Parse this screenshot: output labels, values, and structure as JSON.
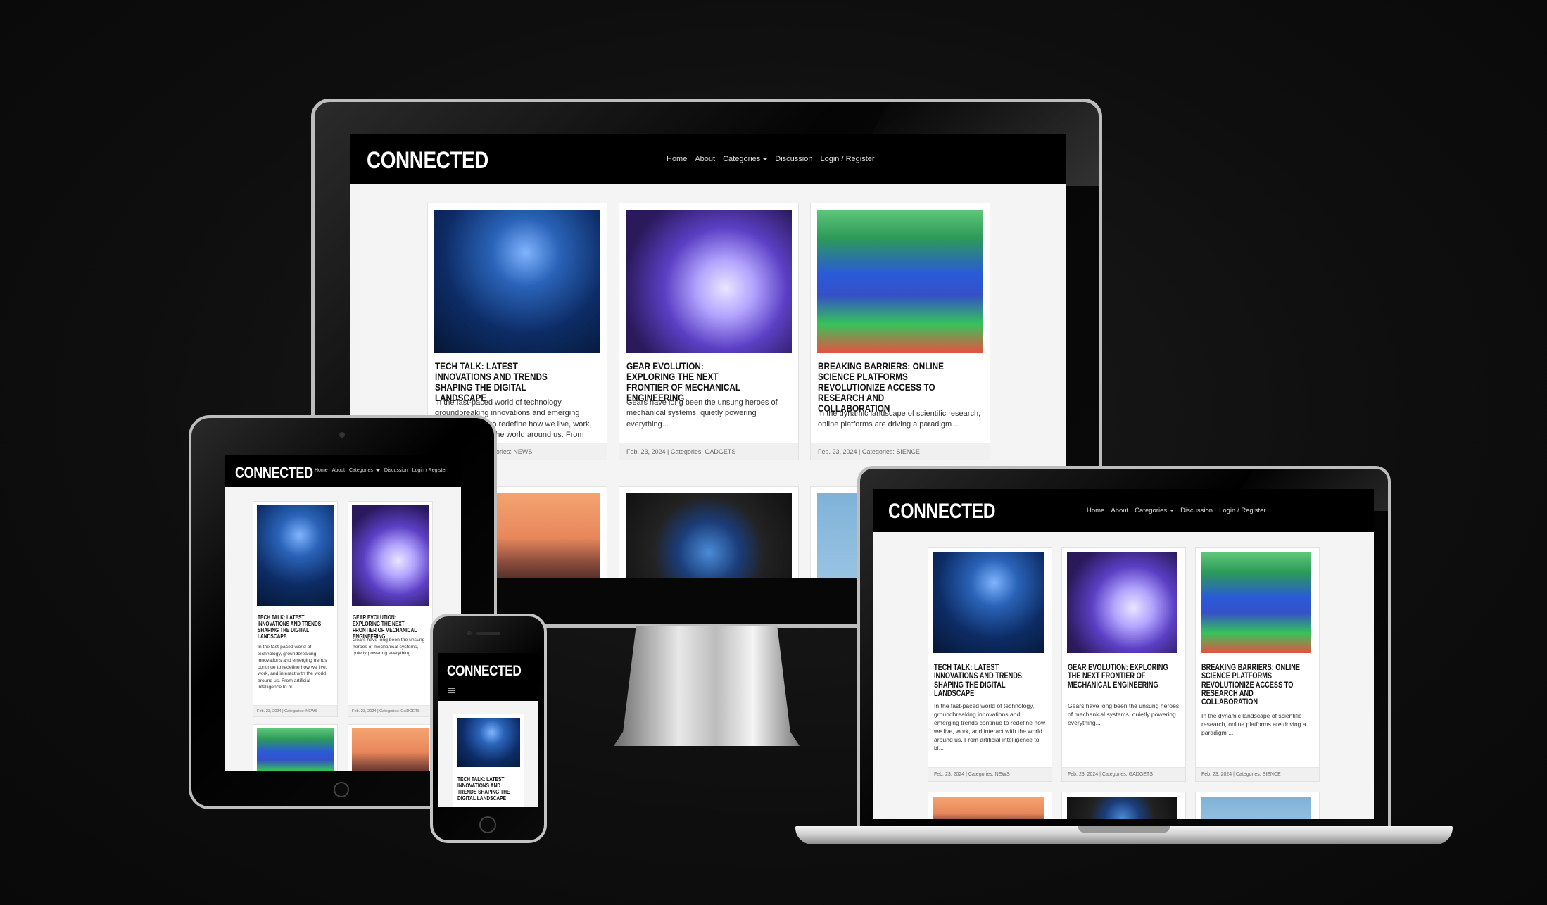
{
  "site": {
    "logo": "CONNECTED",
    "nav": [
      "Home",
      "About",
      "Categories",
      "Discussion",
      "Login / Register"
    ]
  },
  "posts": [
    {
      "title": "Tech Talk: Latest Innovations and Trends Shaping the Digital Landscape",
      "excerpt_full": "In the fast-paced world of technology, groundbreaking innovations and emerging trends continue to redefine how we live, work, and interact with the world around us. From artificial intelligence to bl...",
      "excerpt_monitor": "In the fast-paced world of technology, groundbreaking innovations and emerging trends continue to redefine how we live, work, and interact with the world around us. From artificial intelligence",
      "date": "Feb. 23, 2024",
      "category": "NEWS",
      "footer": "Feb. 23, 2024 | Categories: NEWS",
      "image": "network-hand-image"
    },
    {
      "title": "Gear Evolution: Exploring the Next Frontier of Mechanical Engineering",
      "excerpt_full": "Gears have long been the unsung heroes of mechanical systems, quietly powering everything...",
      "date": "Feb. 23, 2024",
      "category": "GADGETS",
      "footer": "Feb. 23, 2024 | Categories: GADGETS",
      "image": "robot-toy-image"
    },
    {
      "title": "Breaking Barriers: Online Science Platforms Revolutionize Access to Research and Collaboration",
      "excerpt_full": "In the dynamic landscape of scientific research, online platforms are driving a paradigm ...",
      "date": "Feb. 23, 2024",
      "category": "SIENCE",
      "footer": "Feb. 23, 2024 | Categories: SIENCE",
      "image": "vr-corridor-image"
    }
  ],
  "monitor_second_row_images": [
    "sunset-car-image",
    "smartphone-image",
    "sky-image"
  ],
  "colors": {
    "background": "#0e0e0e",
    "nav_bg": "#000000",
    "page_bg": "#f4f4f4",
    "card_bg": "#ffffff"
  }
}
